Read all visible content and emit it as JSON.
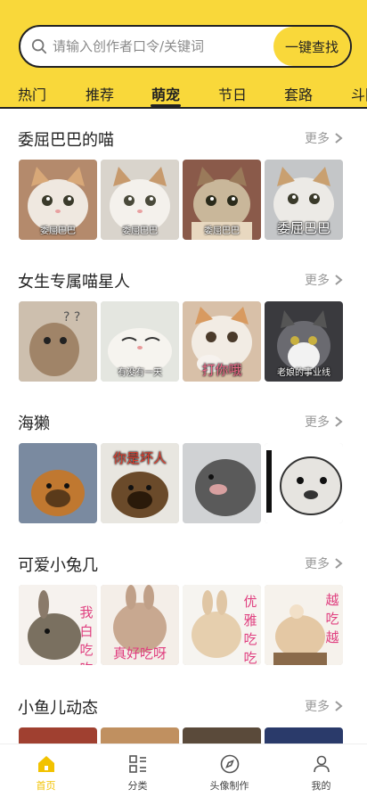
{
  "search": {
    "placeholder": "请输入创作者口令/关键词",
    "button_label": "一键查找"
  },
  "tabs": [
    {
      "label": "热门",
      "active": false
    },
    {
      "label": "推荐",
      "active": false
    },
    {
      "label": "萌宠",
      "active": true
    },
    {
      "label": "节日",
      "active": false
    },
    {
      "label": "套路",
      "active": false
    },
    {
      "label": "斗图",
      "active": false
    }
  ],
  "more_label": "更多",
  "sections": [
    {
      "title": "委屈巴巴的喵",
      "thumbs": [
        {
          "caption": "委屈巴巴",
          "big": false
        },
        {
          "caption": "委屈巴巴",
          "big": false
        },
        {
          "caption": "委屈巴巴",
          "big": false
        },
        {
          "caption": "委屈巴巴",
          "big": true
        }
      ]
    },
    {
      "title": "女生专属喵星人",
      "thumbs": [
        {
          "caption": "",
          "big": false
        },
        {
          "caption": "有没有一天",
          "big": false
        },
        {
          "caption": "打你哦",
          "big": true
        },
        {
          "caption": "老娘的事业线",
          "big": false
        }
      ]
    },
    {
      "title": "海獭",
      "thumbs": [
        {
          "caption": "",
          "big": false
        },
        {
          "caption": "你是坏人",
          "big": true
        },
        {
          "caption": "",
          "big": false
        },
        {
          "caption": "",
          "big": false
        }
      ]
    },
    {
      "title": "可爱小兔几",
      "thumbs": [
        {
          "caption": "我白吃吃",
          "big": true
        },
        {
          "caption": "真好吃呀",
          "big": true
        },
        {
          "caption": "优雅吃吃",
          "big": true
        },
        {
          "caption": "越吃越",
          "big": true
        }
      ]
    },
    {
      "title": "小鱼儿动态",
      "thumbs": [
        {
          "caption": "",
          "big": false
        },
        {
          "caption": "",
          "big": false
        },
        {
          "caption": "",
          "big": false
        },
        {
          "caption": "",
          "big": false
        }
      ]
    }
  ],
  "bottom_nav": [
    {
      "label": "首页",
      "icon": "home-icon",
      "active": true
    },
    {
      "label": "分类",
      "icon": "category-icon",
      "active": false
    },
    {
      "label": "头像制作",
      "icon": "compass-icon",
      "active": false
    },
    {
      "label": "我的",
      "icon": "user-icon",
      "active": false
    }
  ],
  "colors": {
    "accent": "#f9d83a",
    "active_nav": "#f2c200",
    "muted": "#999999"
  }
}
